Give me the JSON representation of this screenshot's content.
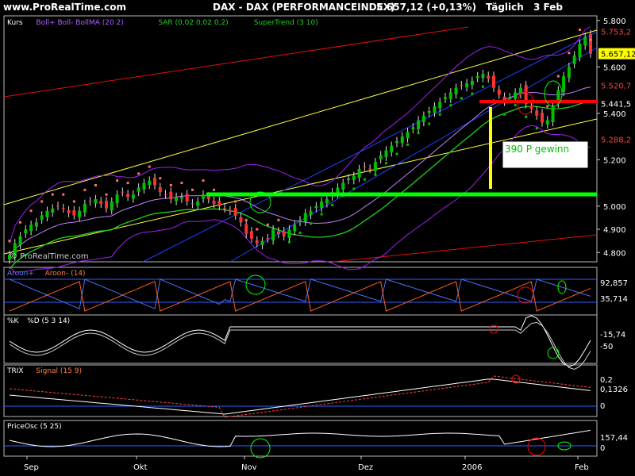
{
  "header": {
    "site": "www.ProRealTime.com",
    "instrument": "DAX - DAX (PERFORMANCEINDEX)",
    "price_change": "5.657,12 (+0,13%)",
    "period": "Täglich",
    "date": "3 Feb"
  },
  "watermark": "© ProRealTime.com",
  "annotation": "390 P gewinn",
  "colors": {
    "background": "#000000",
    "panel_border": "#b8b8b8",
    "bull_candle": "#00c000",
    "bear_candle": "#ff3030",
    "trend_yellow": "#ffff40",
    "trend_blue": "#2040ff",
    "trend_red": "#e01010",
    "bollinger": "#a020f0",
    "sar": "#00c000",
    "sar_bear": "#ff7070",
    "supertrend": "#20d020",
    "marker_green": "#00ff00",
    "marker_red": "#ff0000",
    "marker_yellow": "#ffff00",
    "price_box": "#ffff00"
  },
  "chart_data": [
    {
      "type": "candlestick",
      "panel": "Kurs",
      "legend": [
        "Kurs",
        "Boll+ Boll- BollMA (20 2)",
        "SAR (0,02 0,02 0,2)",
        "SuperTrend (3 10)"
      ],
      "x_labels": [
        "Sep",
        "Okt",
        "Nov",
        "Dez",
        "2006",
        "Feb"
      ],
      "y_ticks": [
        "5.800",
        "5.600",
        "5.400",
        "5.200",
        "5.000",
        "4.900",
        "4.800"
      ],
      "ylim": [
        4760,
        5820
      ],
      "price_labels": [
        "5.753,2",
        "5.657,12",
        "5.520,7",
        "5.441,5",
        "5.288,2"
      ],
      "close": [
        4790,
        4840,
        4870,
        4900,
        4920,
        4930,
        4960,
        4980,
        4990,
        5000,
        4990,
        4970,
        4960,
        4980,
        5010,
        5020,
        5030,
        5010,
        4990,
        5020,
        5050,
        5060,
        5040,
        5050,
        5080,
        5100,
        5110,
        5090,
        5060,
        5050,
        5030,
        5040,
        5040,
        5020,
        5010,
        5020,
        5050,
        5030,
        5010,
        5000,
        4990,
        4980,
        4960,
        4930,
        4880,
        4860,
        4840,
        4850,
        4860,
        4900,
        4880,
        4870,
        4900,
        4920,
        4940,
        4970,
        4980,
        5000,
        5020,
        5030,
        5060,
        5080,
        5100,
        5120,
        5130,
        5160,
        5170,
        5160,
        5190,
        5220,
        5240,
        5260,
        5280,
        5300,
        5320,
        5340,
        5370,
        5390,
        5410,
        5430,
        5450,
        5470,
        5490,
        5510,
        5520,
        5530,
        5540,
        5560,
        5570,
        5550,
        5510,
        5480,
        5450,
        5470,
        5490,
        5510,
        5440,
        5420,
        5390,
        5360,
        5370,
        5430,
        5500,
        5560,
        5600,
        5650,
        5700,
        5730,
        5657
      ]
    },
    {
      "type": "line",
      "panel": "Aroon",
      "legend": [
        "Aroon+",
        "Aroon- (14)"
      ],
      "price_labels": [
        "92,857",
        "35,714"
      ]
    },
    {
      "type": "line",
      "panel": "Stochastic",
      "legend": [
        "%K",
        "%D (5 3 14)"
      ],
      "price_labels": [
        "-15,74"
      ],
      "y_ticks": [
        "-50"
      ]
    },
    {
      "type": "line",
      "panel": "TRIX",
      "legend": [
        "TRIX",
        "Signal (15 9)"
      ],
      "price_labels": [
        "0,1326"
      ],
      "y_ticks": [
        "0,2",
        "0"
      ]
    },
    {
      "type": "line",
      "panel": "PriceOsc",
      "legend": [
        "PriceOsc (5 25)"
      ],
      "price_labels": [
        "157,44"
      ],
      "y_ticks": [
        "0"
      ]
    }
  ]
}
